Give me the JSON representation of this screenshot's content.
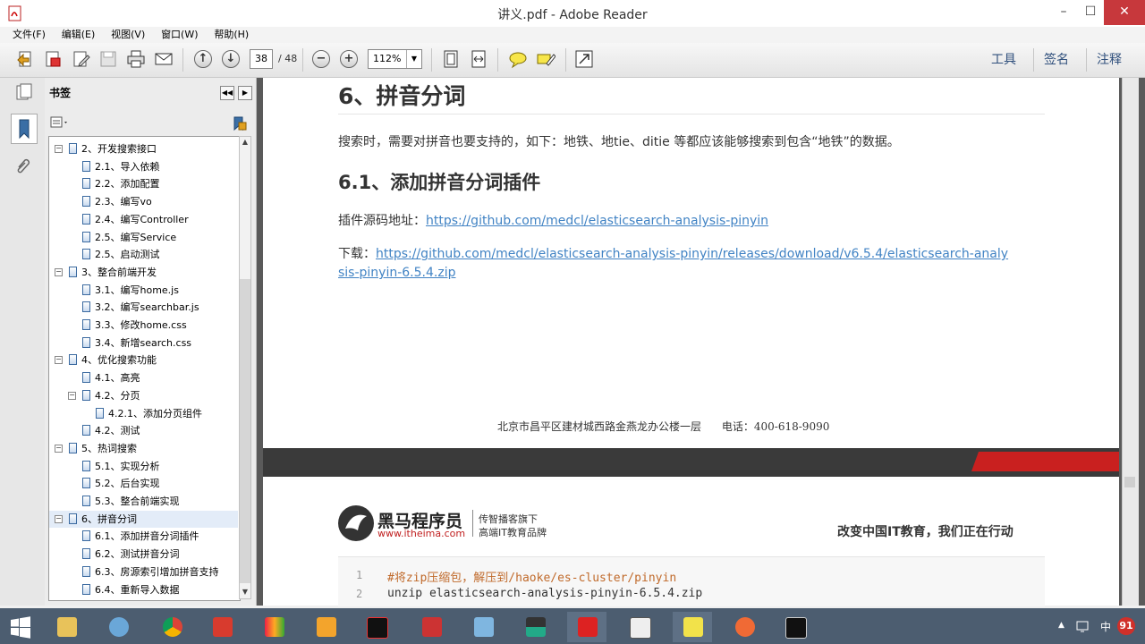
{
  "window": {
    "title": "讲义.pdf - Adobe Reader",
    "controls": [
      "–",
      "☐",
      "✕"
    ]
  },
  "menu": [
    "文件(F)",
    "编辑(E)",
    "视图(V)",
    "窗口(W)",
    "帮助(H)"
  ],
  "toolbar": {
    "current_page": "38",
    "total_pages": "/ 48",
    "zoom": "112%",
    "right_tools": [
      "工具",
      "签名",
      "注释"
    ]
  },
  "bookmarks": {
    "title": "书签",
    "items": [
      {
        "label": "2、开发搜索接口",
        "level": 0,
        "expand": "−"
      },
      {
        "label": "2.1、导入依赖",
        "level": 1,
        "expand": ""
      },
      {
        "label": "2.2、添加配置",
        "level": 1,
        "expand": ""
      },
      {
        "label": "2.3、编写vo",
        "level": 1,
        "expand": ""
      },
      {
        "label": "2.4、编写Controller",
        "level": 1,
        "expand": ""
      },
      {
        "label": "2.5、编写Service",
        "level": 1,
        "expand": ""
      },
      {
        "label": "2.5、启动测试",
        "level": 1,
        "expand": ""
      },
      {
        "label": "3、整合前端开发",
        "level": 0,
        "expand": "−"
      },
      {
        "label": "3.1、编写home.js",
        "level": 1,
        "expand": ""
      },
      {
        "label": "3.2、编写searchbar.js",
        "level": 1,
        "expand": ""
      },
      {
        "label": "3.3、修改home.css",
        "level": 1,
        "expand": ""
      },
      {
        "label": "3.4、新增search.css",
        "level": 1,
        "expand": ""
      },
      {
        "label": "4、优化搜索功能",
        "level": 0,
        "expand": "−"
      },
      {
        "label": "4.1、高亮",
        "level": 1,
        "expand": ""
      },
      {
        "label": "4.2、分页",
        "level": 1,
        "expand": "−"
      },
      {
        "label": "4.2.1、添加分页组件",
        "level": 2,
        "expand": ""
      },
      {
        "label": "4.2、测试",
        "level": 1,
        "expand": ""
      },
      {
        "label": "5、热词搜索",
        "level": 0,
        "expand": "−"
      },
      {
        "label": "5.1、实现分析",
        "level": 1,
        "expand": ""
      },
      {
        "label": "5.2、后台实现",
        "level": 1,
        "expand": ""
      },
      {
        "label": "5.3、整合前端实现",
        "level": 1,
        "expand": ""
      },
      {
        "label": "6、拼音分词",
        "level": 0,
        "expand": "−",
        "selected": true
      },
      {
        "label": "6.1、添加拼音分词插件",
        "level": 1,
        "expand": ""
      },
      {
        "label": "6.2、测试拼音分词",
        "level": 1,
        "expand": ""
      },
      {
        "label": "6.3、房源索引增加拼音支持",
        "level": 1,
        "expand": ""
      },
      {
        "label": "6.4、重新导入数据",
        "level": 1,
        "expand": ""
      }
    ]
  },
  "document": {
    "h1": "6、拼音分词",
    "intro": "搜索时，需要对拼音也要支持的，如下：地铁、地tie、ditie 等都应该能够搜索到包含“地铁”的数据。",
    "h2": "6.1、添加拼音分词插件",
    "source_label": "插件源码地址：",
    "source_url": "https://github.com/medcl/elasticsearch-analysis-pinyin",
    "download_label": "下载：",
    "download_url_line1": "https://github.com/medcl/elasticsearch-analysis-pinyin/releases/download/v6.5.4/elasticsearch-analy",
    "download_url_line2": "sis-pinyin-6.5.4.zip",
    "footer": "北京市昌平区建材城西路金燕龙办公楼一层      电话：400-618-9090",
    "brand_name": "黑马程序员",
    "brand_url": "www.itheima.com",
    "brand_sub1": "传智播客旗下",
    "brand_sub2": "高端IT教育品牌",
    "slogan": "改变中国IT教育，我们正在行动",
    "code": [
      {
        "n": "1",
        "text": "#将zip压缩包，解压到/haoke/es-cluster/pinyin",
        "comment": true
      },
      {
        "n": "2",
        "text": "unzip elasticsearch-analysis-pinyin-6.5.4.zip",
        "comment": false
      }
    ]
  },
  "taskbar": {
    "ime": "中",
    "badge": "91"
  },
  "colors": {
    "accent_red": "#c9201f",
    "link": "#4183c4",
    "taskbar": "#4c5d70"
  }
}
